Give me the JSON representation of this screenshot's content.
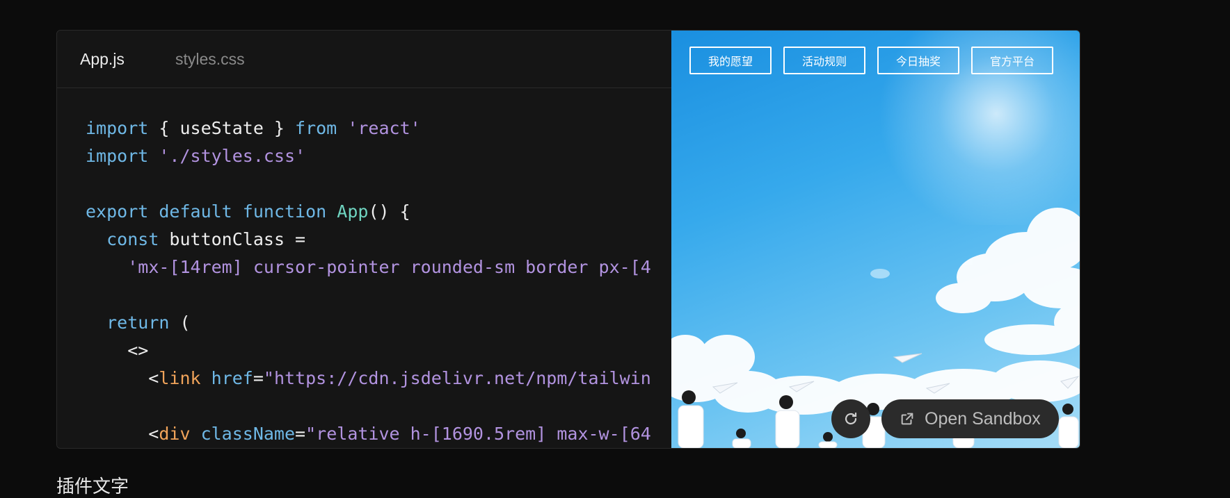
{
  "tabs": [
    {
      "label": "App.js",
      "active": true
    },
    {
      "label": "styles.css",
      "active": false
    }
  ],
  "code_lines": [
    [
      {
        "t": "import",
        "c": "kw"
      },
      {
        "t": " { useState } ",
        "c": "pl"
      },
      {
        "t": "from",
        "c": "kw"
      },
      {
        "t": " ",
        "c": "pl"
      },
      {
        "t": "'react'",
        "c": "str"
      }
    ],
    [
      {
        "t": "import",
        "c": "kw"
      },
      {
        "t": " ",
        "c": "pl"
      },
      {
        "t": "'./styles.css'",
        "c": "str"
      }
    ],
    [],
    [
      {
        "t": "export",
        "c": "kw"
      },
      {
        "t": " ",
        "c": "pl"
      },
      {
        "t": "default",
        "c": "kw"
      },
      {
        "t": " ",
        "c": "pl"
      },
      {
        "t": "function",
        "c": "kw"
      },
      {
        "t": " ",
        "c": "pl"
      },
      {
        "t": "App",
        "c": "fn"
      },
      {
        "t": "() {",
        "c": "pl"
      }
    ],
    [
      {
        "t": "  ",
        "c": "pl"
      },
      {
        "t": "const",
        "c": "kw"
      },
      {
        "t": " buttonClass =",
        "c": "pl"
      }
    ],
    [
      {
        "t": "    ",
        "c": "pl"
      },
      {
        "t": "'mx-[14rem] cursor-pointer rounded-sm border px-[4",
        "c": "str"
      }
    ],
    [],
    [
      {
        "t": "  ",
        "c": "pl"
      },
      {
        "t": "return",
        "c": "kw"
      },
      {
        "t": " (",
        "c": "pl"
      }
    ],
    [
      {
        "t": "    <>",
        "c": "pl"
      }
    ],
    [
      {
        "t": "      <",
        "c": "pl"
      },
      {
        "t": "link",
        "c": "tag"
      },
      {
        "t": " ",
        "c": "pl"
      },
      {
        "t": "href",
        "c": "attr"
      },
      {
        "t": "=",
        "c": "pl"
      },
      {
        "t": "\"https://cdn.jsdelivr.net/npm/tailwin",
        "c": "str"
      }
    ],
    [],
    [
      {
        "t": "      <",
        "c": "pl"
      },
      {
        "t": "div",
        "c": "tag"
      },
      {
        "t": " ",
        "c": "pl"
      },
      {
        "t": "className",
        "c": "attr"
      },
      {
        "t": "=",
        "c": "pl"
      },
      {
        "t": "\"relative h-[1690.5rem] max-w-[64",
        "c": "str"
      }
    ]
  ],
  "preview": {
    "nav_buttons": [
      "我的愿望",
      "活动规则",
      "今日抽奖",
      "官方平台"
    ],
    "open_sandbox_label": "Open Sandbox"
  },
  "below_text": "插件文字",
  "colors": {
    "background": "#0c0c0c",
    "editor_bg": "#151515",
    "keyword": "#6fb8e6",
    "string": "#b293e0",
    "function": "#6fd4c0",
    "tag": "#f0a35a",
    "sky": "#36a9ec"
  },
  "icons": {
    "refresh": "refresh-icon",
    "open": "external-link-icon"
  }
}
